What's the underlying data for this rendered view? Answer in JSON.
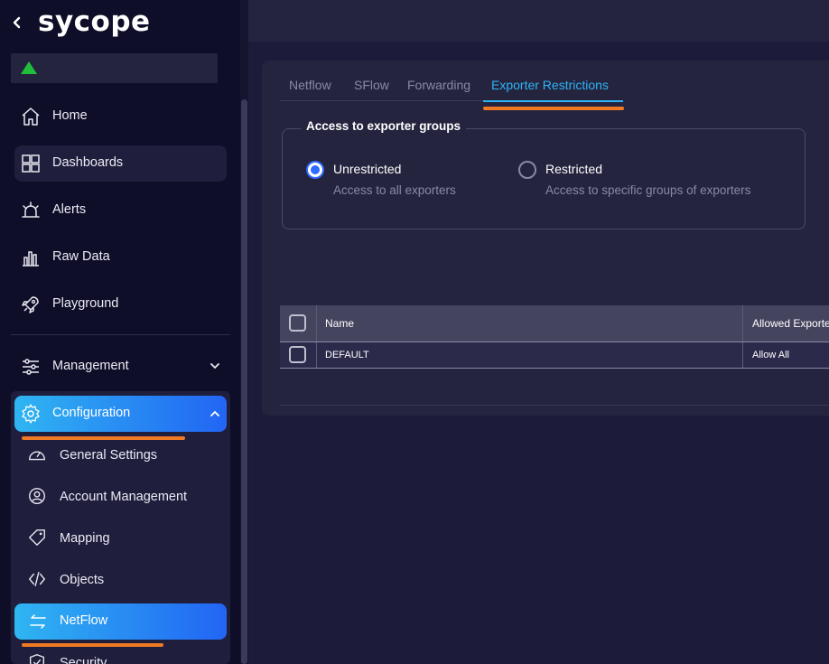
{
  "sidebar": {
    "logo_text": "sycope",
    "nav": [
      {
        "label": "Home",
        "icon": "home-icon"
      },
      {
        "label": "Dashboards",
        "icon": "dashboards-icon"
      },
      {
        "label": "Alerts",
        "icon": "alert-siren-icon"
      },
      {
        "label": "Raw Data",
        "icon": "bar-chart-icon"
      },
      {
        "label": "Playground",
        "icon": "rocket-icon"
      }
    ],
    "management": {
      "label": "Management",
      "icon": "sliders-icon"
    },
    "configuration": {
      "label": "Configuration",
      "icon": "gear-icon",
      "items": [
        {
          "label": "General Settings",
          "icon": "gauge-icon"
        },
        {
          "label": "Account Management",
          "icon": "user-circle-icon"
        },
        {
          "label": "Mapping",
          "icon": "tag-icon"
        },
        {
          "label": "Objects",
          "icon": "code-icon"
        },
        {
          "label": "NetFlow",
          "icon": "arrows-exchange-icon"
        },
        {
          "label": "Security",
          "icon": "shield-check-icon"
        }
      ]
    }
  },
  "tabs": [
    {
      "label": "Netflow"
    },
    {
      "label": "SFlow"
    },
    {
      "label": "Forwarding"
    },
    {
      "label": "Exporter Restrictions",
      "active": true
    }
  ],
  "access": {
    "legend": "Access to exporter groups",
    "options": [
      {
        "title": "Unrestricted",
        "desc": "Access to all exporters",
        "checked": true
      },
      {
        "title": "Restricted",
        "desc": "Access to specific groups of exporters",
        "checked": false
      }
    ]
  },
  "table": {
    "columns": [
      "Name",
      "Allowed Exporters"
    ],
    "rows": [
      {
        "name": "DEFAULT",
        "allowed": "Allow All"
      }
    ]
  },
  "colors": {
    "accent": "#2db4f5",
    "active_gradient_start": "#2fb5f2",
    "active_gradient_end": "#2265f4",
    "highlight_underline": "#f07a24",
    "status_green": "#1fbf3b"
  }
}
